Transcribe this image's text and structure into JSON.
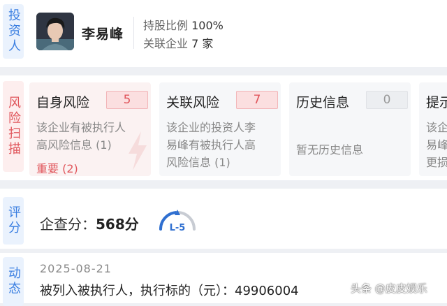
{
  "investor": {
    "side_label": "投资人",
    "name": "李易峰",
    "share_label": "持股比例",
    "share_value": "100%",
    "related_label": "关联企业",
    "related_value": "7 家"
  },
  "risk": {
    "side_label": "风险扫描",
    "cards": [
      {
        "title": "自身风险",
        "count": "5",
        "desc_lines": [
          "该企业有被执行人",
          "高风险信息 (1)"
        ],
        "note": "重要 (2)"
      },
      {
        "title": "关联风险",
        "count": "7",
        "desc_lines": [
          "该企业的投资人李",
          "易峰有被执行人高",
          "风险信息 (1)"
        ]
      },
      {
        "title": "历史信息",
        "count": "0",
        "desc_lines": [
          "暂无历史信息"
        ]
      },
      {
        "title": "提示",
        "desc_lines": [
          "该企",
          "易峰",
          "更损"
        ]
      }
    ]
  },
  "score": {
    "side_label": "评分",
    "label": "企查分：",
    "value": "568分",
    "level": "L-5"
  },
  "dynamic": {
    "side_label": "动态",
    "date": "2025-08-21",
    "text": "被列入被执行人，执行标的（元）：49906004"
  },
  "watermark": "头条 @皮皮娱乐",
  "colors": {
    "accent_blue": "#3b7fe1",
    "risk_red": "#e0555b"
  }
}
